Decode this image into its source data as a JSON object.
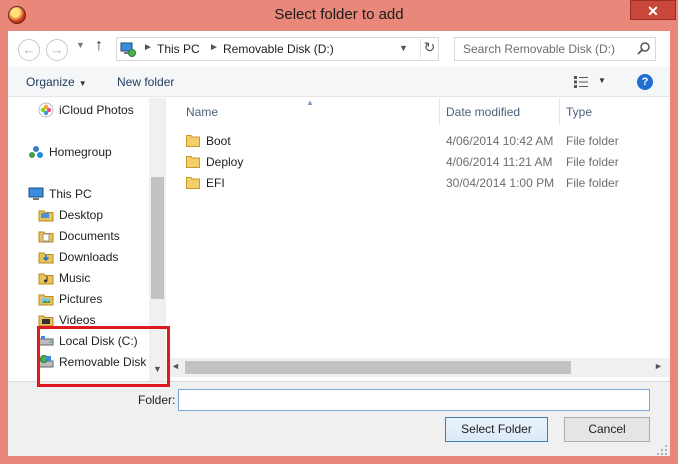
{
  "window": {
    "title": "Select folder to add",
    "close_glyph": "✕"
  },
  "nav": {
    "back_glyph": "←",
    "forward_glyph": "→",
    "up_glyph": "↑",
    "breadcrumbs": [
      "This PC",
      "Removable Disk (D:)"
    ],
    "refresh_glyph": "↻",
    "search_placeholder": "Search Removable Disk (D:)"
  },
  "toolbar": {
    "organize": "Organize",
    "new_folder": "New folder",
    "help_glyph": "?"
  },
  "sidebar": {
    "items": [
      {
        "label": "iCloud Photos",
        "icon": "icloud-photos-icon"
      },
      {
        "label": "Homegroup",
        "icon": "homegroup-icon"
      },
      {
        "label": "This PC",
        "icon": "computer-icon"
      },
      {
        "label": "Desktop",
        "icon": "folder-icon"
      },
      {
        "label": "Documents",
        "icon": "folder-icon"
      },
      {
        "label": "Downloads",
        "icon": "folder-icon"
      },
      {
        "label": "Music",
        "icon": "folder-icon"
      },
      {
        "label": "Pictures",
        "icon": "folder-icon"
      },
      {
        "label": "Videos",
        "icon": "folder-icon"
      },
      {
        "label": "Local Disk (C:)",
        "icon": "drive-icon"
      },
      {
        "label": "Removable Disk (",
        "icon": "removable-drive-icon"
      }
    ]
  },
  "files": {
    "columns": [
      "Name",
      "Date modified",
      "Type"
    ],
    "rows": [
      {
        "name": "Boot",
        "date": "4/06/2014 10:42 AM",
        "type": "File folder"
      },
      {
        "name": "Deploy",
        "date": "4/06/2014 11:21 AM",
        "type": "File folder"
      },
      {
        "name": "EFI",
        "date": "30/04/2014 1:00 PM",
        "type": "File folder"
      }
    ]
  },
  "footer": {
    "folder_label": "Folder:",
    "folder_value": "",
    "select_button": "Select Folder",
    "cancel_button": "Cancel"
  },
  "colors": {
    "frame": "#e8877a",
    "highlight_box": "#e0191f",
    "accent": "#1e6fd0"
  }
}
